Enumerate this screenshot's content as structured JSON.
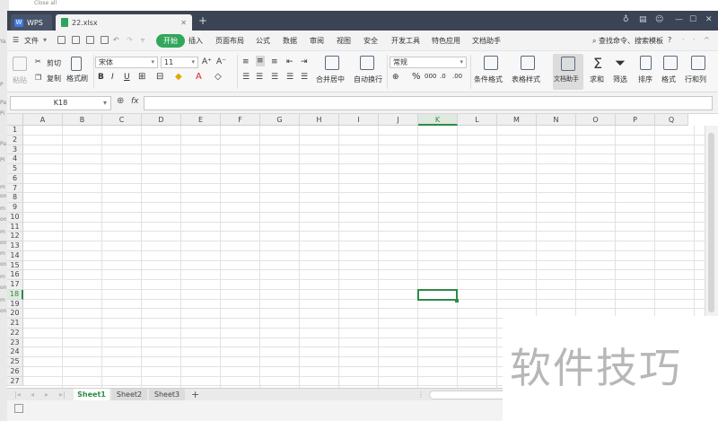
{
  "ghost_text": {
    "top": "Close all",
    "side": [
      "Ya",
      "P",
      "Pa",
      "Pi",
      "Pa",
      "Pl",
      "m",
      "on",
      "m",
      "on",
      "m",
      "on",
      "m",
      "on",
      "m",
      "on",
      "m",
      "on"
    ]
  },
  "titlebar": {
    "app_tab": "WPS",
    "file_tab": "22.xlsx",
    "new_tab": "+"
  },
  "menu": {
    "file": "文件",
    "start": "开始",
    "items": [
      "插入",
      "页面布局",
      "公式",
      "数据",
      "审阅",
      "视图",
      "安全",
      "开发工具",
      "特色应用",
      "文档助手"
    ],
    "search": "查找命令、搜索模板",
    "help": "?"
  },
  "ribbon": {
    "paste": "粘贴",
    "cut": "剪切",
    "copy": "复制",
    "format_painter": "格式刷",
    "font": "宋体",
    "font_size": "11",
    "bold": "B",
    "italic": "I",
    "underline": "U",
    "merge": "合并居中",
    "wrap": "自动换行",
    "number_format": "常规",
    "percent": "%",
    "cond_format": "条件格式",
    "table_style": "表格样式",
    "doc_assistant": "文档助手",
    "sum": "求和",
    "filter": "筛选",
    "sort": "排序",
    "format": "格式",
    "row_col": "行和列"
  },
  "formula_bar": {
    "name_box": "K18",
    "fx": "fx",
    "value": ""
  },
  "grid": {
    "columns": [
      "A",
      "B",
      "C",
      "D",
      "E",
      "F",
      "G",
      "H",
      "I",
      "J",
      "K",
      "L",
      "M",
      "N",
      "O",
      "P",
      "Q"
    ],
    "rows": [
      "1",
      "2",
      "3",
      "4",
      "5",
      "6",
      "7",
      "8",
      "9",
      "10",
      "11",
      "12",
      "13",
      "14",
      "15",
      "16",
      "17",
      "18",
      "19",
      "20",
      "21",
      "22",
      "23",
      "24",
      "25",
      "26",
      "27"
    ],
    "selected_cell": "K18",
    "selected_column": "K",
    "selected_row": "18"
  },
  "sheets": [
    "Sheet1",
    "Sheet2",
    "Sheet3"
  ],
  "active_sheet": "Sheet1",
  "add_sheet": "+",
  "watermark": "软件技巧",
  "colors": {
    "accent": "#2e8a47",
    "start_button": "#32a65b",
    "titlebar": "#3b4454"
  }
}
